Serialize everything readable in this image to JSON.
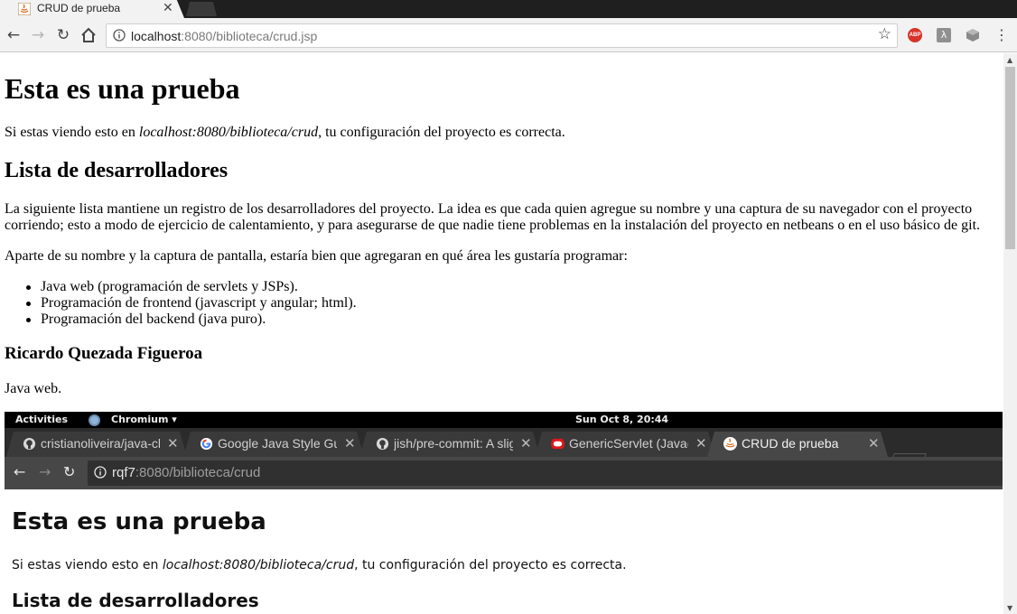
{
  "browser": {
    "tab_title": "CRUD de prueba",
    "url_host": "localhost",
    "url_rest": ":8080/biblioteca/crud.jsp",
    "extensions": [
      "abp-icon",
      "lambda-icon",
      "cube-icon"
    ],
    "abp_label": "ABP",
    "lambda_label": "λ"
  },
  "page": {
    "h1": "Esta es una prueba",
    "intro_before": "Si estas viendo esto en ",
    "intro_em": "localhost:8080/biblioteca/crud",
    "intro_after": ", tu configuración del proyecto es correcta.",
    "h2": "Lista de desarrolladores",
    "para1_line1": "La siguiente lista mantiene un registro de los desarrolladores del proyecto. La idea es que cada quien agregue su nombre y una captura de su navegador con el proyecto",
    "para1_line2": "corriendo; esto a modo de ejercicio de calentamiento, y para asegurarse de que nadie tiene problemas en la instalación del proyecto en netbeans o en el uso básico de git.",
    "para2": "Aparte de su nombre y la captura de pantalla, estaría bien que agregaran en qué área les gustaría programar:",
    "list": [
      "Java web (programación de servlets y JSPs).",
      "Programación de frontend (javascript y angular; html).",
      "Programación del backend (java puro)."
    ],
    "dev_name": "Ricardo Quezada Figueroa",
    "dev_area": "Java web."
  },
  "screenshot": {
    "activities": "Activities",
    "app_name": "Chromium ▾",
    "clock": "Sun Oct  8, 20:44",
    "tabs": [
      {
        "title": "cristianoliveira/java-ch",
        "icon": "github-icon"
      },
      {
        "title": "Google Java Style Gui",
        "icon": "google-icon"
      },
      {
        "title": "jish/pre-commit: A slig",
        "icon": "github-icon"
      },
      {
        "title": "GenericServlet (Java(T",
        "icon": "oracle-icon"
      },
      {
        "title": "CRUD de prueba",
        "icon": "java-icon"
      }
    ],
    "url_host": "rqf7",
    "url_rest": ":8080/biblioteca/crud",
    "h1": "Esta es una prueba",
    "intro_before": "Si estas viendo esto en ",
    "intro_em": "localhost:8080/biblioteca/crud",
    "intro_after": ", tu configuración del proyecto es correcta.",
    "h2": "Lista de desarrolladores"
  }
}
